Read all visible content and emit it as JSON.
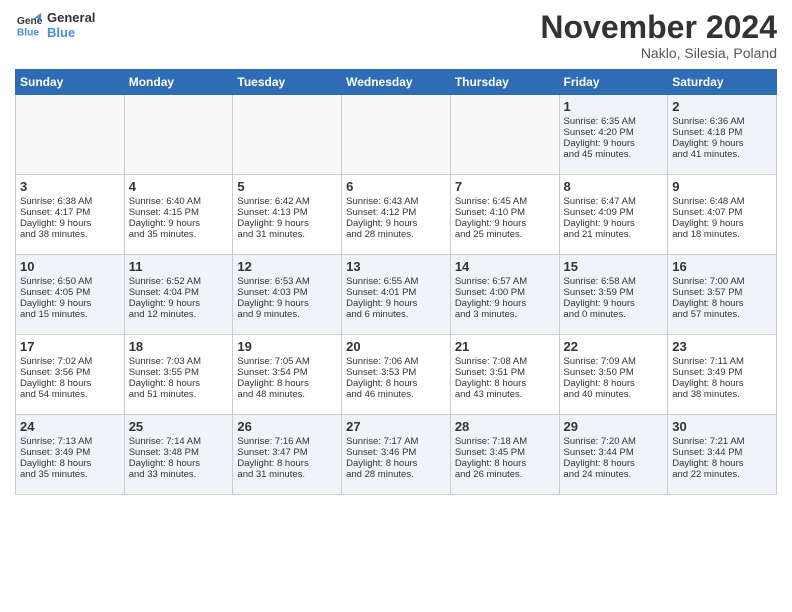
{
  "logo": {
    "line1": "General",
    "line2": "Blue"
  },
  "title": "November 2024",
  "location": "Naklo, Silesia, Poland",
  "days_header": [
    "Sunday",
    "Monday",
    "Tuesday",
    "Wednesday",
    "Thursday",
    "Friday",
    "Saturday"
  ],
  "weeks": [
    [
      {
        "day": "",
        "info": ""
      },
      {
        "day": "",
        "info": ""
      },
      {
        "day": "",
        "info": ""
      },
      {
        "day": "",
        "info": ""
      },
      {
        "day": "",
        "info": ""
      },
      {
        "day": "1",
        "info": "Sunrise: 6:35 AM\nSunset: 4:20 PM\nDaylight: 9 hours\nand 45 minutes."
      },
      {
        "day": "2",
        "info": "Sunrise: 6:36 AM\nSunset: 4:18 PM\nDaylight: 9 hours\nand 41 minutes."
      }
    ],
    [
      {
        "day": "3",
        "info": "Sunrise: 6:38 AM\nSunset: 4:17 PM\nDaylight: 9 hours\nand 38 minutes."
      },
      {
        "day": "4",
        "info": "Sunrise: 6:40 AM\nSunset: 4:15 PM\nDaylight: 9 hours\nand 35 minutes."
      },
      {
        "day": "5",
        "info": "Sunrise: 6:42 AM\nSunset: 4:13 PM\nDaylight: 9 hours\nand 31 minutes."
      },
      {
        "day": "6",
        "info": "Sunrise: 6:43 AM\nSunset: 4:12 PM\nDaylight: 9 hours\nand 28 minutes."
      },
      {
        "day": "7",
        "info": "Sunrise: 6:45 AM\nSunset: 4:10 PM\nDaylight: 9 hours\nand 25 minutes."
      },
      {
        "day": "8",
        "info": "Sunrise: 6:47 AM\nSunset: 4:09 PM\nDaylight: 9 hours\nand 21 minutes."
      },
      {
        "day": "9",
        "info": "Sunrise: 6:48 AM\nSunset: 4:07 PM\nDaylight: 9 hours\nand 18 minutes."
      }
    ],
    [
      {
        "day": "10",
        "info": "Sunrise: 6:50 AM\nSunset: 4:05 PM\nDaylight: 9 hours\nand 15 minutes."
      },
      {
        "day": "11",
        "info": "Sunrise: 6:52 AM\nSunset: 4:04 PM\nDaylight: 9 hours\nand 12 minutes."
      },
      {
        "day": "12",
        "info": "Sunrise: 6:53 AM\nSunset: 4:03 PM\nDaylight: 9 hours\nand 9 minutes."
      },
      {
        "day": "13",
        "info": "Sunrise: 6:55 AM\nSunset: 4:01 PM\nDaylight: 9 hours\nand 6 minutes."
      },
      {
        "day": "14",
        "info": "Sunrise: 6:57 AM\nSunset: 4:00 PM\nDaylight: 9 hours\nand 3 minutes."
      },
      {
        "day": "15",
        "info": "Sunrise: 6:58 AM\nSunset: 3:59 PM\nDaylight: 9 hours\nand 0 minutes."
      },
      {
        "day": "16",
        "info": "Sunrise: 7:00 AM\nSunset: 3:57 PM\nDaylight: 8 hours\nand 57 minutes."
      }
    ],
    [
      {
        "day": "17",
        "info": "Sunrise: 7:02 AM\nSunset: 3:56 PM\nDaylight: 8 hours\nand 54 minutes."
      },
      {
        "day": "18",
        "info": "Sunrise: 7:03 AM\nSunset: 3:55 PM\nDaylight: 8 hours\nand 51 minutes."
      },
      {
        "day": "19",
        "info": "Sunrise: 7:05 AM\nSunset: 3:54 PM\nDaylight: 8 hours\nand 48 minutes."
      },
      {
        "day": "20",
        "info": "Sunrise: 7:06 AM\nSunset: 3:53 PM\nDaylight: 8 hours\nand 46 minutes."
      },
      {
        "day": "21",
        "info": "Sunrise: 7:08 AM\nSunset: 3:51 PM\nDaylight: 8 hours\nand 43 minutes."
      },
      {
        "day": "22",
        "info": "Sunrise: 7:09 AM\nSunset: 3:50 PM\nDaylight: 8 hours\nand 40 minutes."
      },
      {
        "day": "23",
        "info": "Sunrise: 7:11 AM\nSunset: 3:49 PM\nDaylight: 8 hours\nand 38 minutes."
      }
    ],
    [
      {
        "day": "24",
        "info": "Sunrise: 7:13 AM\nSunset: 3:49 PM\nDaylight: 8 hours\nand 35 minutes."
      },
      {
        "day": "25",
        "info": "Sunrise: 7:14 AM\nSunset: 3:48 PM\nDaylight: 8 hours\nand 33 minutes."
      },
      {
        "day": "26",
        "info": "Sunrise: 7:16 AM\nSunset: 3:47 PM\nDaylight: 8 hours\nand 31 minutes."
      },
      {
        "day": "27",
        "info": "Sunrise: 7:17 AM\nSunset: 3:46 PM\nDaylight: 8 hours\nand 28 minutes."
      },
      {
        "day": "28",
        "info": "Sunrise: 7:18 AM\nSunset: 3:45 PM\nDaylight: 8 hours\nand 26 minutes."
      },
      {
        "day": "29",
        "info": "Sunrise: 7:20 AM\nSunset: 3:44 PM\nDaylight: 8 hours\nand 24 minutes."
      },
      {
        "day": "30",
        "info": "Sunrise: 7:21 AM\nSunset: 3:44 PM\nDaylight: 8 hours\nand 22 minutes."
      }
    ]
  ]
}
